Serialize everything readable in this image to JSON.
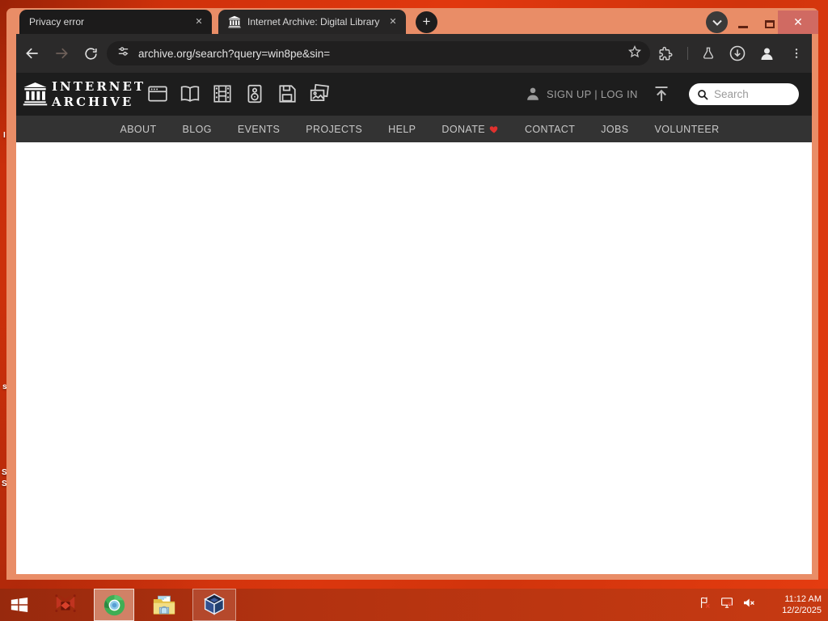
{
  "browser": {
    "tabs": [
      {
        "title": "Privacy error",
        "active": false
      },
      {
        "title": "Internet Archive: Digital Library",
        "active": true
      }
    ],
    "new_tab_label": "+",
    "close_label": "✕",
    "window_close_glyph": "✕",
    "url": "archive.org/search?query=win8pe&sin="
  },
  "page": {
    "logo": {
      "line1": "INTERNET",
      "line2": "ARCHIVE"
    },
    "media_types": [
      "web",
      "texts",
      "video",
      "audio",
      "software",
      "images"
    ],
    "auth": "SIGN UP | LOG IN",
    "search_placeholder": "Search",
    "nav": [
      "ABOUT",
      "BLOG",
      "EVENTS",
      "PROJECTS",
      "HELP",
      "DONATE",
      "CONTACT",
      "JOBS",
      "VOLUNTEER"
    ]
  },
  "desktop": {
    "icon_label_fragments": [
      "I",
      "s",
      "S",
      "S"
    ],
    "taskbar_apps": [
      "start",
      "app-red",
      "browser",
      "file-explorer",
      "virtualbox"
    ],
    "tray": {
      "time": "11:12 AM",
      "date": "12/2/2025"
    }
  },
  "colors": {
    "frame": "#e98d67",
    "toolbar": "#2b2a2a",
    "header": "#1d1d1d",
    "nav": "#333333",
    "donate_heart": "#e0312e",
    "close_button": "#d06a62"
  }
}
